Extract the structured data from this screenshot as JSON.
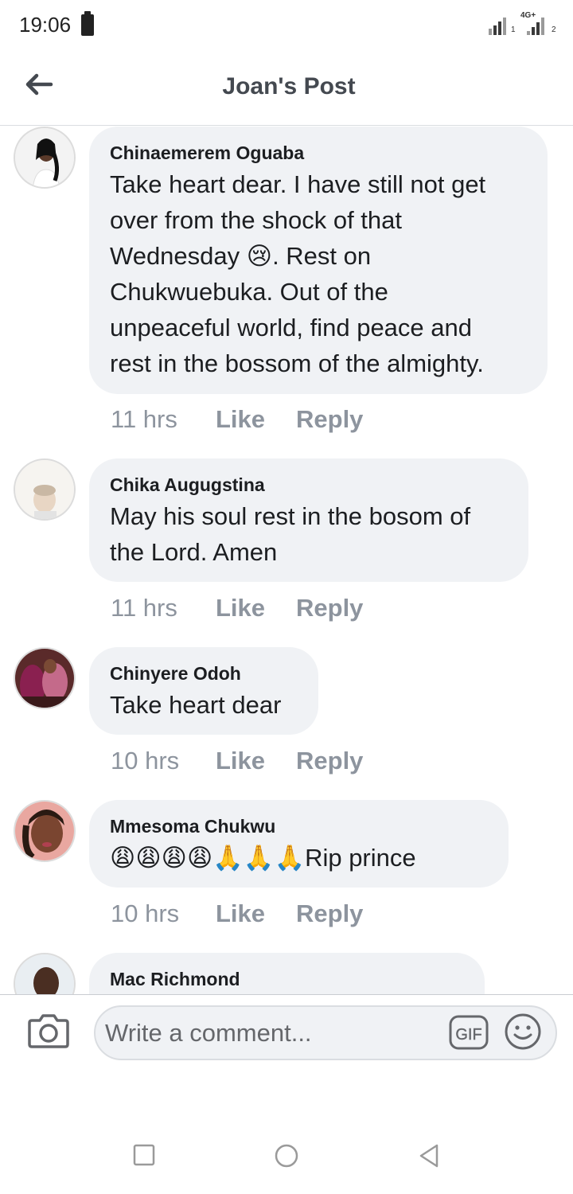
{
  "status_bar": {
    "time": "19:06",
    "network_label": "4G+",
    "sim1_label": "1",
    "sim2_label": "2"
  },
  "header": {
    "title": "Joan's Post",
    "back_icon": "arrow-left-icon"
  },
  "comments": [
    {
      "author": "Chinaemerem Oguaba",
      "text": "Take heart dear. I have still not get\nover from the shock of that\nWednesday 😢. Rest on\nChukwuebuka. Out of the\nunpeaceful world, find peace and\nrest in the bossom of the almighty.",
      "time": "11 hrs",
      "like_label": "Like",
      "reply_label": "Reply"
    },
    {
      "author": "Chika Augugstina",
      "text": "May his soul rest in the bosom of\nthe Lord. Amen",
      "time": "11 hrs",
      "like_label": "Like",
      "reply_label": "Reply"
    },
    {
      "author": "Chinyere Odoh",
      "text": "Take heart dear",
      "time": "10 hrs",
      "like_label": "Like",
      "reply_label": "Reply"
    },
    {
      "author": "Mmesoma Chukwu",
      "text": "😩😩😩😩🙏🙏🙏Rip prince",
      "time": "10 hrs",
      "like_label": "Like",
      "reply_label": "Reply"
    },
    {
      "author": "Mac Richmond",
      "text": "",
      "time": "",
      "like_label": "",
      "reply_label": ""
    }
  ],
  "composer": {
    "placeholder": "Write a comment...",
    "gif_label": "GIF",
    "camera_icon": "camera-icon",
    "emoji_icon": "smiley-icon"
  },
  "nav_bar": {
    "icons": [
      "recents-square-icon",
      "home-circle-icon",
      "back-triangle-icon"
    ]
  },
  "colors": {
    "bubble": "#f0f2f5",
    "meta_text": "#8d949e",
    "title": "#444950"
  }
}
